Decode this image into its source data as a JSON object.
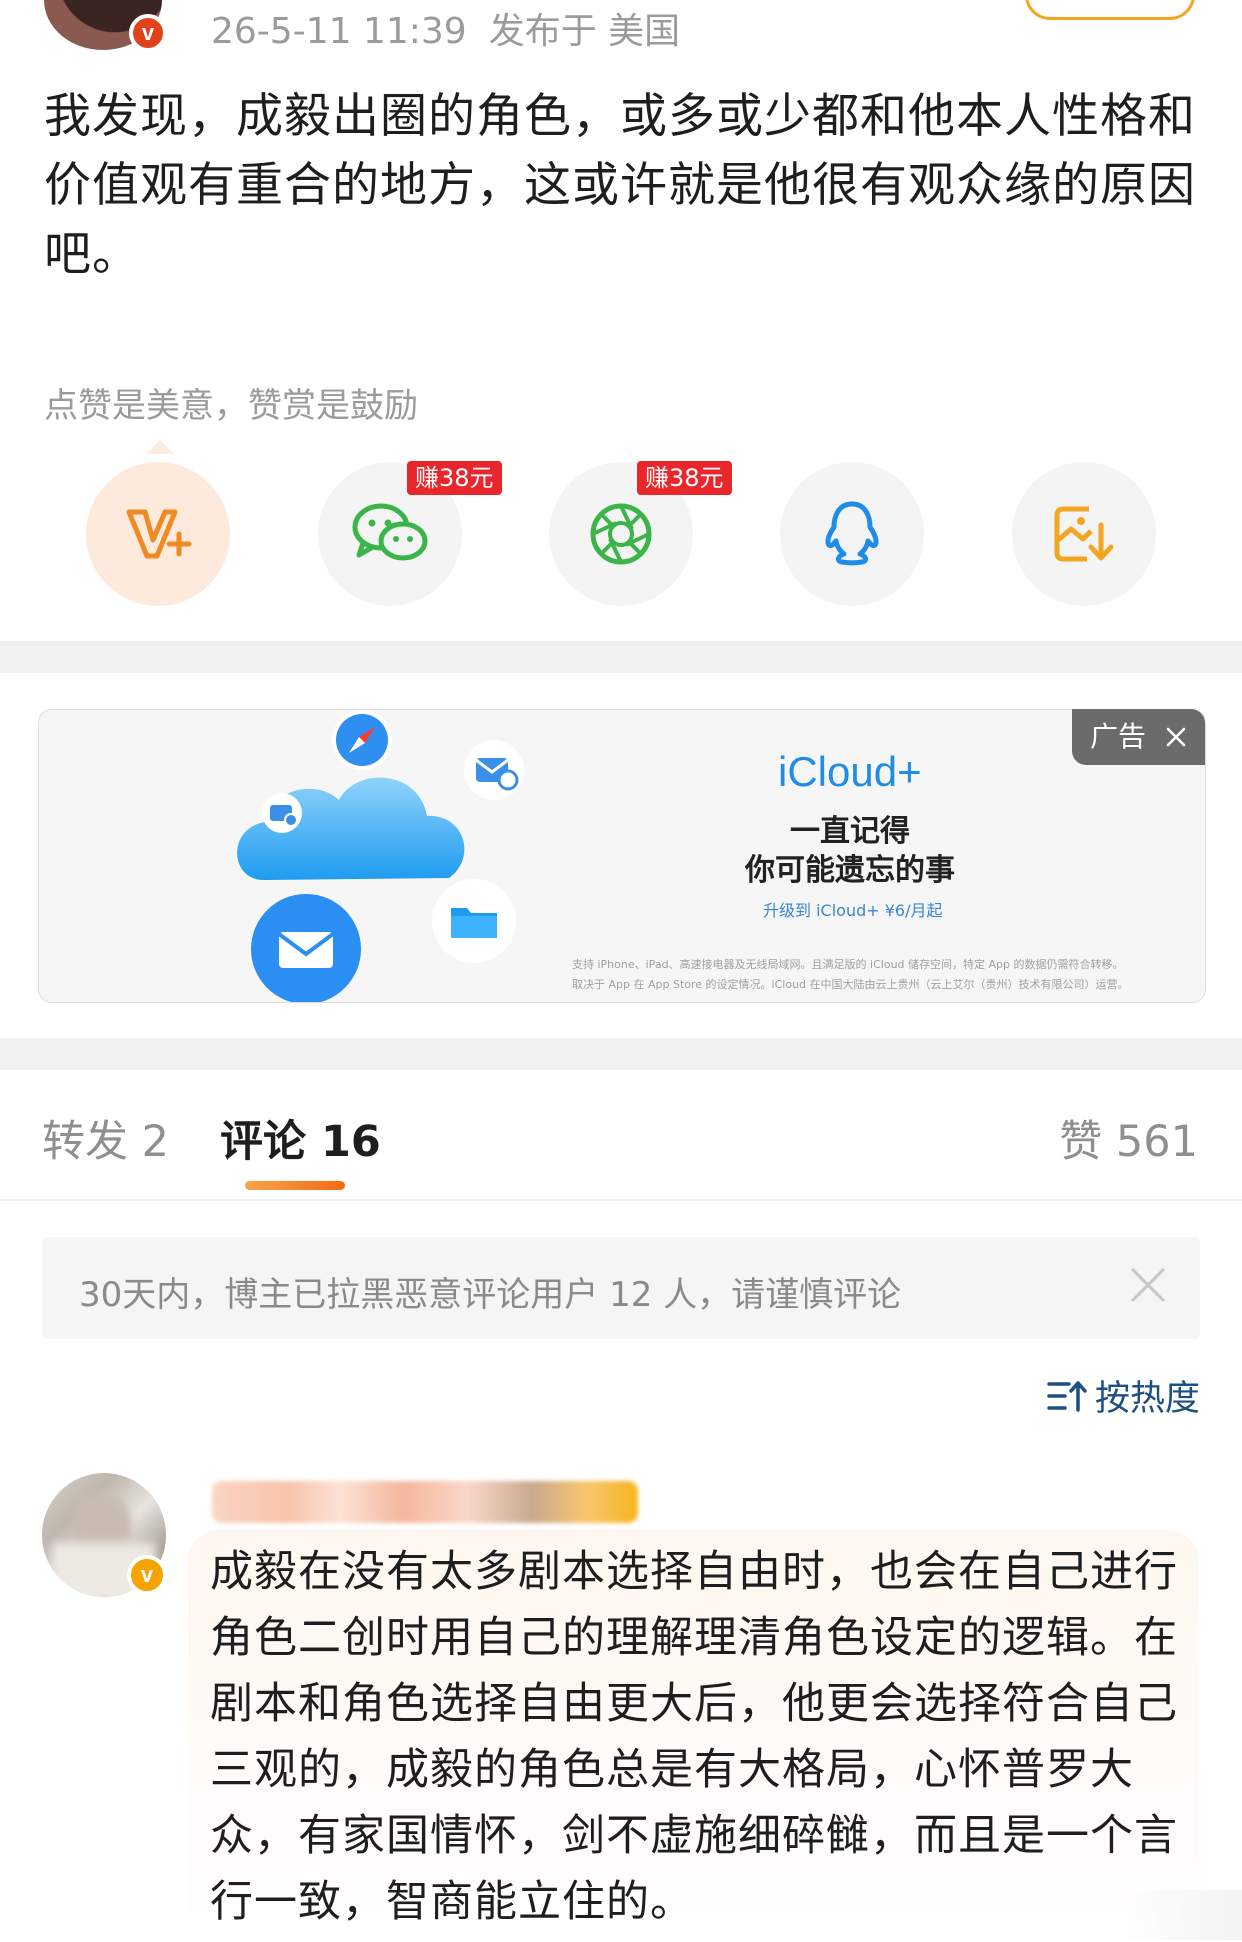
{
  "post": {
    "timestamp": "26-5-11 11:39",
    "location": "发布于 美国",
    "body": "我发现，成毅出圈的角色，或多或少都和他本人性格和价值观有重合的地方，这或许就是他很有观众缘的原因吧。"
  },
  "reward": {
    "hint": "点赞是美意，赞赏是鼓励",
    "share_targets": [
      {
        "icon": "reward-v-plus-icon"
      },
      {
        "icon": "wechat-icon",
        "tag": "赚38元"
      },
      {
        "icon": "moments-icon",
        "tag": "赚38元"
      },
      {
        "icon": "qq-icon"
      },
      {
        "icon": "save-image-icon"
      }
    ]
  },
  "ad": {
    "brand": "iCloud+",
    "line1": "一直记得",
    "line2": "你可能遗忘的事",
    "promo": "升级到 iCloud+ ¥6/月起",
    "fine_print_1": "支持 iPhone、iPad、高速接电器及无线局域网。且满足版的 iCloud 储存空间，特定 App 的数据仍需符合转移。",
    "fine_print_2": "取决于 App 在 App Store 的设定情况。iCloud 在中国大陆由云上贵州（云上艾尔（贵州）技术有限公司）运营。",
    "tag": "广告"
  },
  "tabs": {
    "repost": "转发 2",
    "comments": "评论 16",
    "likes": "赞 561"
  },
  "notice": {
    "text": "30天内，博主已拉黑恶意评论用户 12 人，请谨慎评论"
  },
  "sort": {
    "label": "按热度"
  },
  "comment": {
    "text": "成毅在没有太多剧本选择自由时，也会在自己进行角色二创时用自己的理解理清角色设定的逻辑。在剧本和角色选择自由更大后，他更会选择符合自己三观的，成毅的角色总是有大格局，心怀普罗大众，有家国情怀，剑不虚施细碎雠，而且是一个言行一致，智商能立住的。"
  },
  "colors": {
    "accent": "#f36b12",
    "wechat": "#3bb549",
    "qq": "#1f8de8",
    "save": "#f4a623",
    "earn_tag": "#e8262b",
    "link": "#1b4f86"
  }
}
